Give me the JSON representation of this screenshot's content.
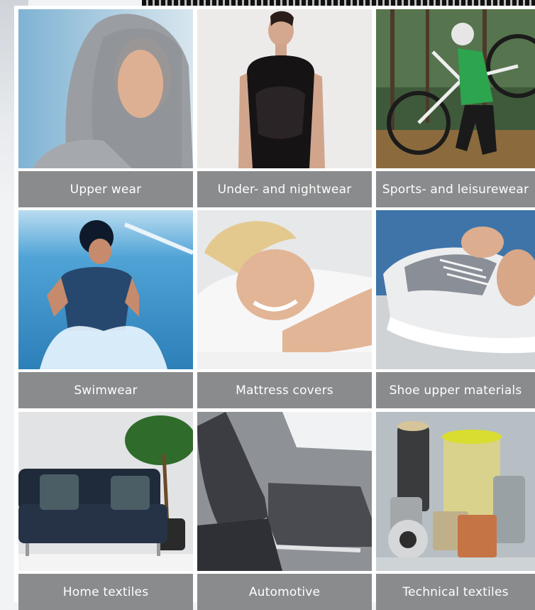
{
  "tiles": [
    {
      "label": "Upper wear",
      "icon": "hooded-woman-photo"
    },
    {
      "label": "Under- and nightwear",
      "icon": "lace-bodysuit-photo"
    },
    {
      "label": "Sports- and leisurewear",
      "icon": "cyclist-photo"
    },
    {
      "label": "Swimwear",
      "icon": "swimmer-photo"
    },
    {
      "label": "Mattress covers",
      "icon": "smiling-woman-pillow-photo"
    },
    {
      "label": "Shoe upper materials",
      "icon": "sneaker-lacing-photo"
    },
    {
      "label": "Home textiles",
      "icon": "sofa-cushions-photo"
    },
    {
      "label": "Automotive",
      "icon": "car-seat-photo"
    },
    {
      "label": "Technical textiles",
      "icon": "yarn-spools-photo"
    }
  ],
  "colors": {
    "caption_bg": "#8a8b8d",
    "caption_text": "#ffffff"
  }
}
